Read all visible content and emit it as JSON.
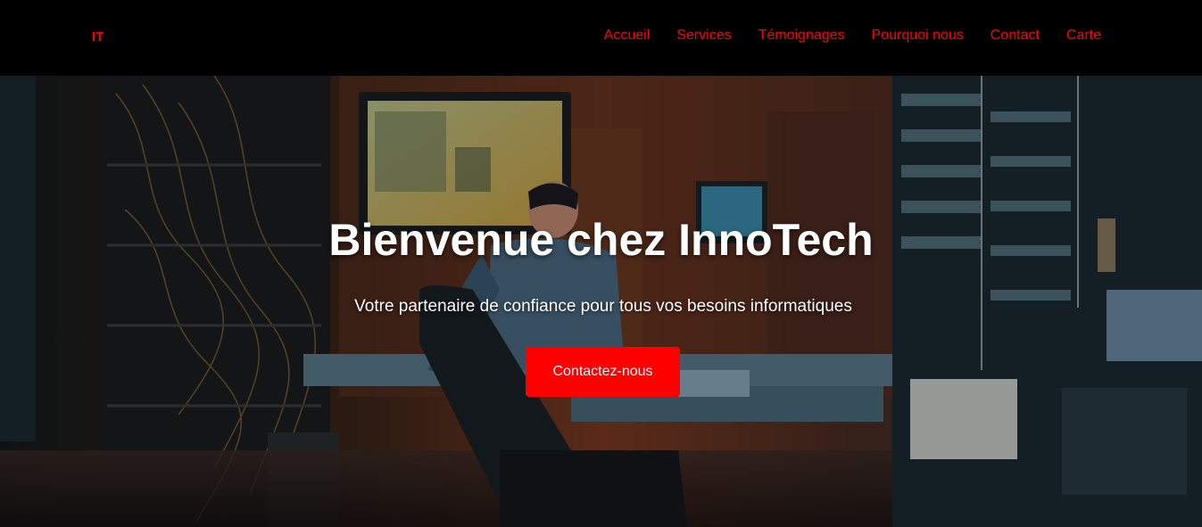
{
  "header": {
    "logo": "IT",
    "nav": [
      {
        "label": "Accueil"
      },
      {
        "label": "Services"
      },
      {
        "label": "Témoignages"
      },
      {
        "label": "Pourquoi nous"
      },
      {
        "label": "Contact"
      },
      {
        "label": "Carte"
      }
    ]
  },
  "hero": {
    "title": "Bienvenue chez InnoTech",
    "subtitle": "Votre partenaire de confiance pour tous vos besoins informatiques",
    "cta_label": "Contactez-nous"
  },
  "colors": {
    "accent": "#ff0000",
    "navbar_bg": "#000000",
    "hero_text": "#ffffff"
  }
}
